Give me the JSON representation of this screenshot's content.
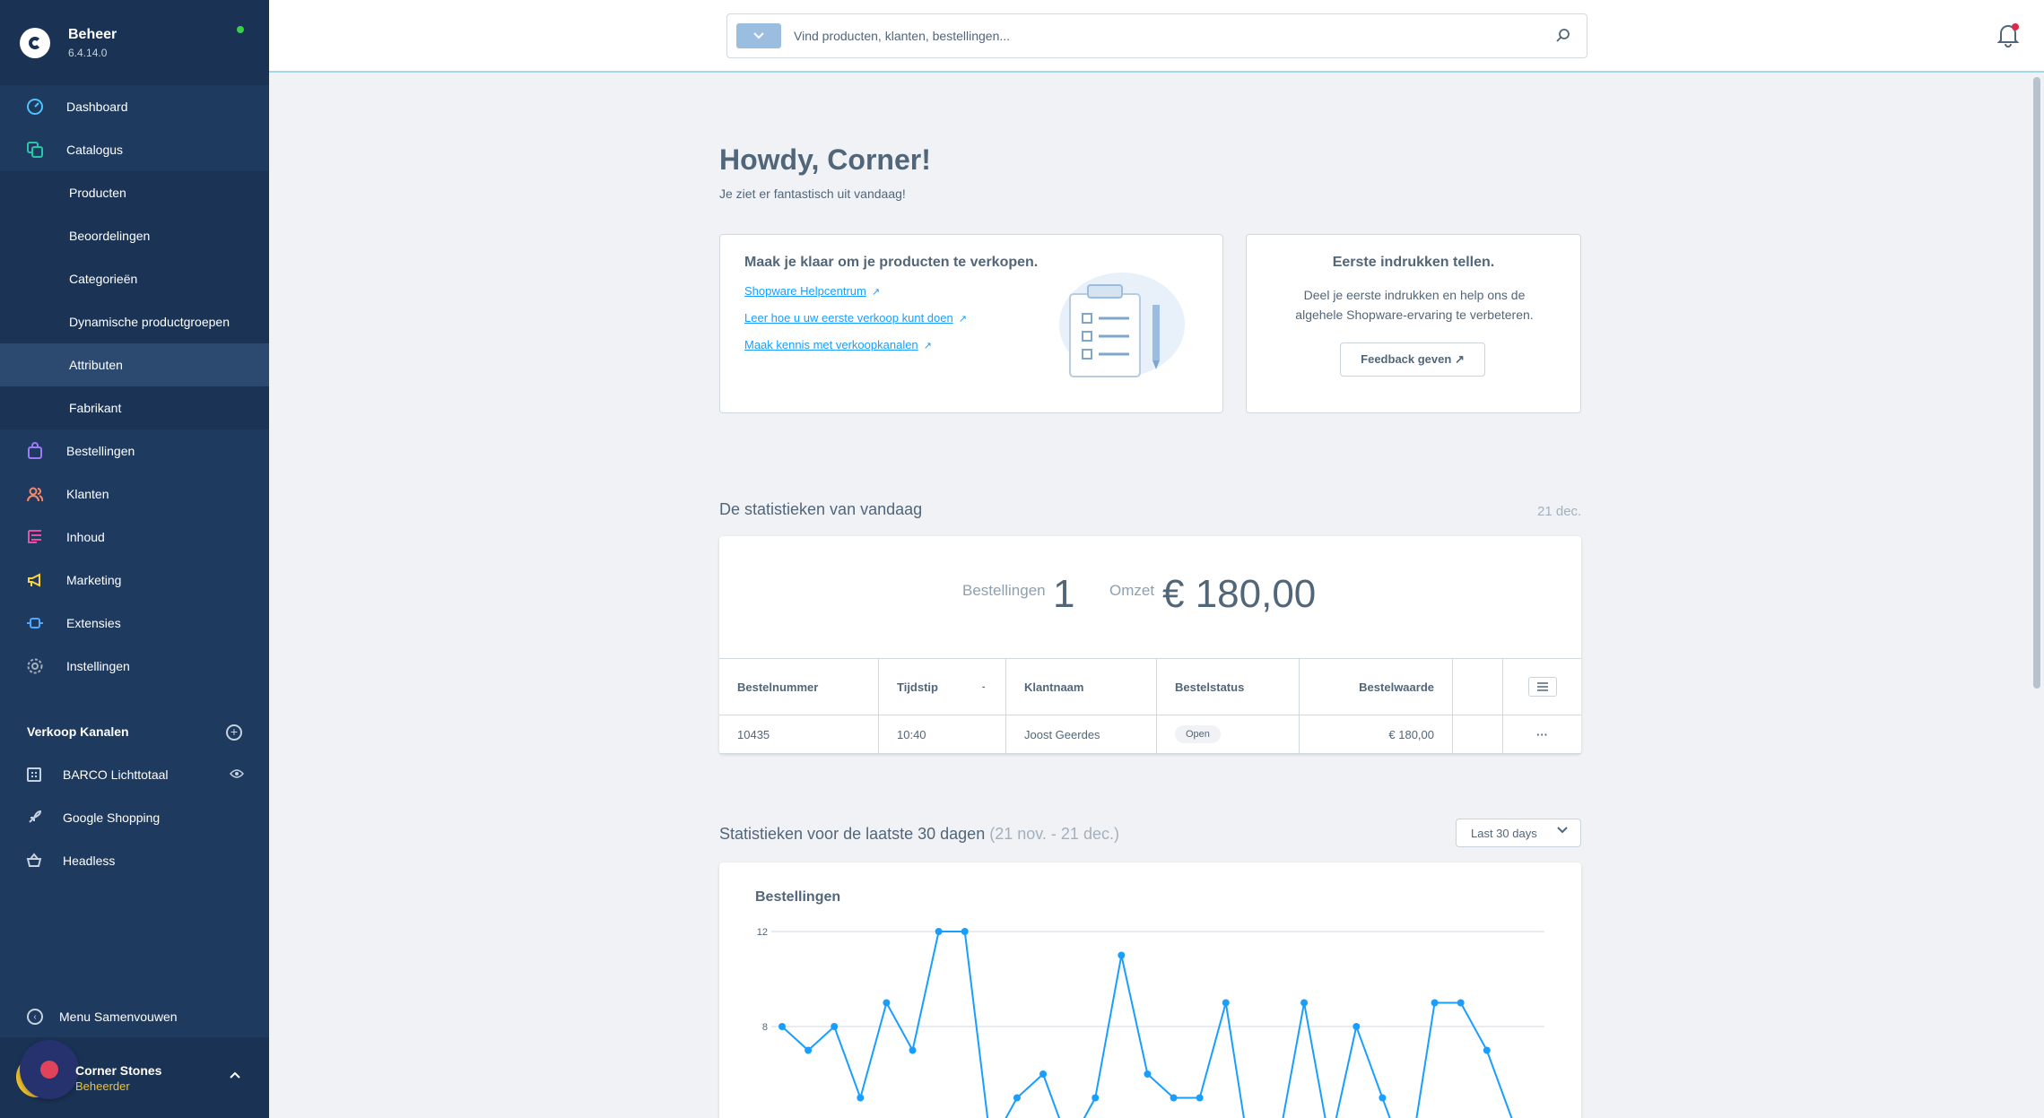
{
  "brand": {
    "name": "Beheer",
    "version": "6.4.14.0"
  },
  "nav": {
    "dashboard": "Dashboard",
    "catalogus": "Catalogus",
    "catalogus_sub": [
      "Producten",
      "Beoordelingen",
      "Categorieën",
      "Dynamische productgroepen",
      "Attributen",
      "Fabrikant"
    ],
    "bestellingen": "Bestellingen",
    "klanten": "Klanten",
    "inhoud": "Inhoud",
    "marketing": "Marketing",
    "extensies": "Extensies",
    "instellingen": "Instellingen"
  },
  "sales_channels": {
    "title": "Verkoop Kanalen",
    "items": [
      "BARCO Lichttotaal",
      "Google Shopping",
      "Headless"
    ]
  },
  "collapse_label": "Menu Samenvouwen",
  "user": {
    "name": "Corner Stones",
    "role": "Beheerder"
  },
  "search": {
    "placeholder": "Vind producten, klanten, bestellingen..."
  },
  "greeting": {
    "title": "Howdy, Corner!",
    "subtitle": "Je ziet er fantastisch uit vandaag!"
  },
  "learn_card": {
    "title": "Maak je klaar om je producten te verkopen.",
    "links": [
      "Shopware Helpcentrum",
      "Leer hoe u uw eerste verkoop kunt doen",
      "Maak kennis met verkoopkanalen"
    ]
  },
  "feedback_card": {
    "title": "Eerste indrukken tellen.",
    "text": "Deel je eerste indrukken en help ons de algehele Shopware-ervaring te verbeteren.",
    "button": "Feedback geven"
  },
  "today": {
    "title": "De statistieken van vandaag",
    "date": "21 dec.",
    "orders_label": "Bestellingen",
    "orders_value": "1",
    "revenue_label": "Omzet",
    "revenue_value": "€ 180,00"
  },
  "orders_table": {
    "headers": [
      "Bestelnummer",
      "Tijdstip",
      "Klantnaam",
      "Bestelstatus",
      "Bestelwaarde"
    ],
    "rows": [
      {
        "number": "10435",
        "time": "10:40",
        "customer": "Joost Geerdes",
        "status": "Open",
        "value": "€ 180,00"
      }
    ]
  },
  "stats30": {
    "title": "Statistieken voor de laatste 30 dagen",
    "range": "(21 nov. - 21 dec.)",
    "select": "Last 30 days"
  },
  "chart_data": {
    "type": "line",
    "title": "Bestellingen",
    "y_ticks": [
      "12",
      "8"
    ],
    "ylim": [
      4,
      12
    ],
    "color": "#189eff",
    "values": [
      8,
      7,
      8,
      5,
      9,
      7,
      12,
      12,
      3,
      5,
      6,
      3,
      5,
      11,
      6,
      5,
      5,
      9,
      2,
      3,
      9,
      3,
      8,
      5,
      2,
      9,
      9,
      7,
      4,
      3
    ]
  },
  "colors": {
    "sidebar": "#1e3a5f",
    "accent": "#189eff",
    "status_online": "#37d046",
    "role": "#f1c12e"
  }
}
